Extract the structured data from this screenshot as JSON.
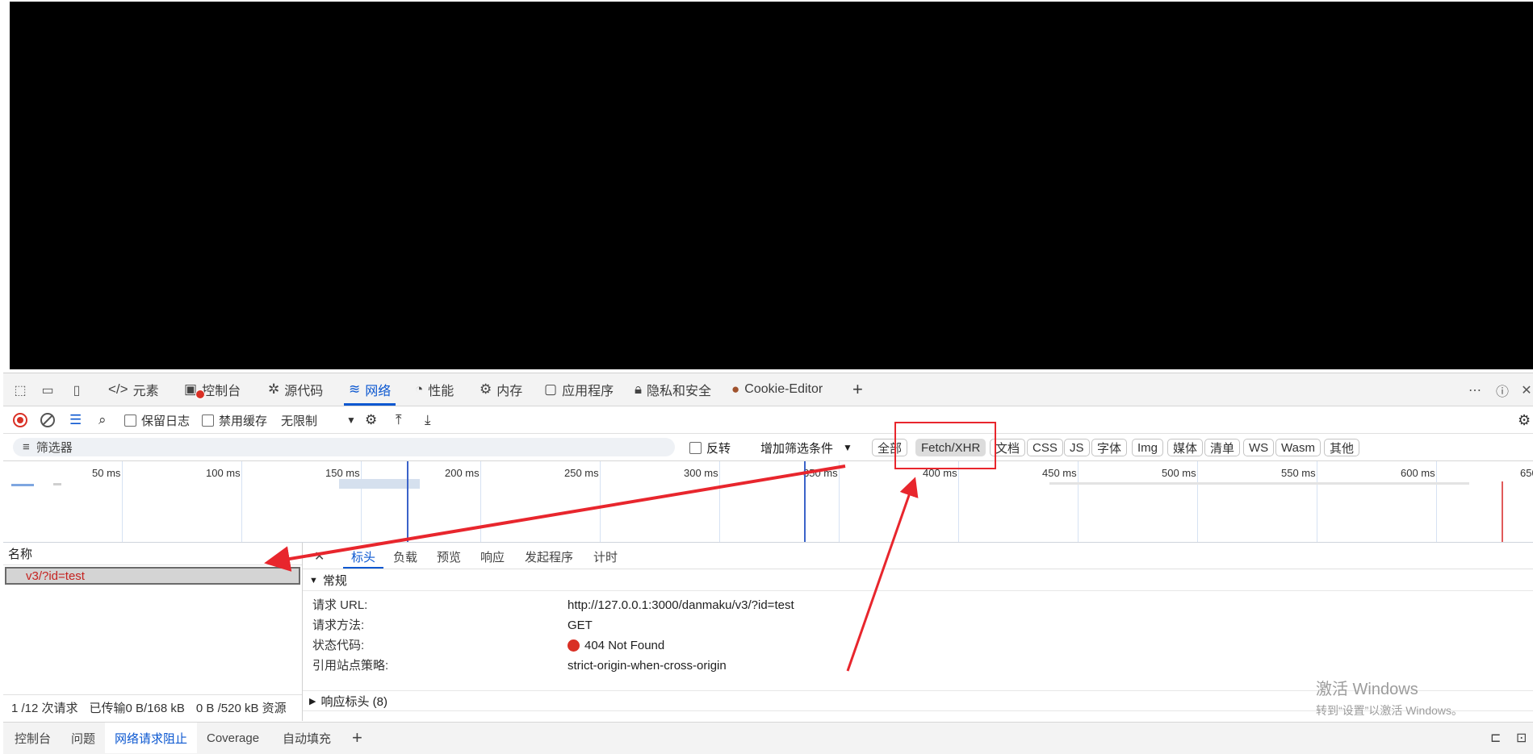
{
  "tabs": {
    "elements": "元素",
    "console": "控制台",
    "sources": "源代码",
    "network": "网络",
    "performance": "性能",
    "memory": "内存",
    "application": "应用程序",
    "privacy": "隐私和安全",
    "cookie_editor": "Cookie-Editor",
    "add": "+"
  },
  "toolbar": {
    "preserve_log": "保留日志",
    "disable_cache": "禁用缓存",
    "throttle": "无限制"
  },
  "filter": {
    "placeholder": "筛选器",
    "invert": "反转",
    "more_filters": "增加筛选条件",
    "types": [
      "全部",
      "Fetch/XHR",
      "文档",
      "CSS",
      "JS",
      "字体",
      "Img",
      "媒体",
      "清单",
      "WS",
      "Wasm",
      "其他"
    ],
    "active_type": "Fetch/XHR"
  },
  "timeline": {
    "ticks": [
      "50 ms",
      "100 ms",
      "150 ms",
      "200 ms",
      "250 ms",
      "300 ms",
      "350 ms",
      "400 ms",
      "450 ms",
      "500 ms",
      "550 ms",
      "600 ms",
      "650"
    ]
  },
  "requests": {
    "name_header": "名称",
    "items": [
      {
        "name": "v3/?id=test",
        "status": "error"
      }
    ],
    "summary": {
      "count": "1 /12 次请求",
      "transferred": "已传输0 B/168 kB",
      "resources": "0 B /520 kB 资源"
    }
  },
  "detail": {
    "tabs": [
      "标头",
      "负载",
      "预览",
      "响应",
      "发起程序",
      "计时"
    ],
    "active_tab": "标头",
    "general": {
      "title": "常规",
      "rows": [
        {
          "key": "请求 URL:",
          "value": "http://127.0.0.1:3000/danmaku/v3/?id=test"
        },
        {
          "key": "请求方法:",
          "value": "GET"
        },
        {
          "key": "状态代码:",
          "value": "404 Not Found"
        },
        {
          "key": "引用站点策略:",
          "value": "strict-origin-when-cross-origin"
        }
      ]
    },
    "response_headers": "响应标头 (8)"
  },
  "drawer": {
    "tabs": [
      "控制台",
      "问题",
      "网络请求阻止",
      "Coverage",
      "自动填充"
    ],
    "active_tab": "网络请求阻止",
    "add": "+"
  },
  "watermark": {
    "line1": "激活 Windows",
    "line2": "转到“设置”以激活 Windows。"
  },
  "colors": {
    "accent": "#0b57d0",
    "error": "#d93025",
    "annotation": "#e8262d"
  },
  "icons": {
    "status_code": "red-dot-icon",
    "record": "record-icon",
    "clear": "clear-icon"
  }
}
